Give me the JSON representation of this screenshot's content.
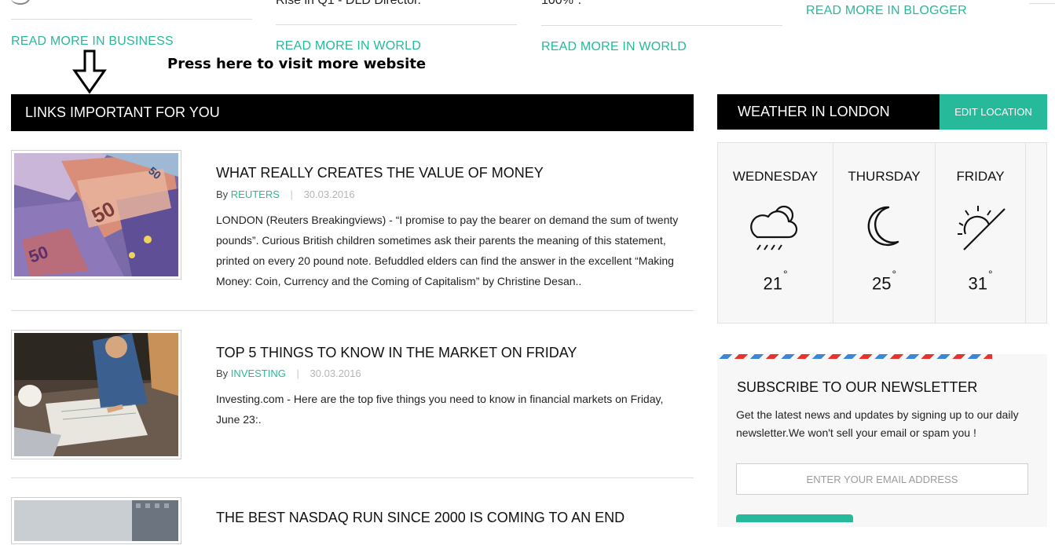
{
  "top_links": {
    "col1": "READ MORE IN BUSINESS",
    "col2_cut": "Rise in Q1 - DLD Director.",
    "col2": "READ MORE IN WORLD",
    "col3_cut": "100%\".",
    "col3": "READ MORE IN WORLD",
    "col4": "READ MORE IN BLOGGER"
  },
  "annotation": {
    "text": "Press here to visit more website"
  },
  "links_section": {
    "title": "LINKS IMPORTANT FOR YOU"
  },
  "articles": [
    {
      "title": "WHAT REALLY CREATES THE VALUE OF MONEY",
      "by": "By",
      "source": "REUTERS",
      "sep": "|",
      "date": "30.03.2016",
      "excerpt": "LONDON (Reuters Breakingviews) - “I promise to pay the bearer on demand the sum of twenty pounds”. Curious British children sometimes ask their parents the meaning of this statement, printed on every 20 pound note. Befuddled elders can find the answer in the excellent “Making Money: Coin, Currency and the Coming of Capitalism” by Christine Desan..",
      "image": "euro-banknotes-photo"
    },
    {
      "title": "TOP 5 THINGS TO KNOW IN THE MARKET ON FRIDAY",
      "by": "By",
      "source": "INVESTING",
      "sep": "|",
      "date": "30.03.2016",
      "excerpt": "Investing.com - Here are the top five things you need to know in financial markets on Friday, June 23:.",
      "image": "office-desk-photo"
    },
    {
      "title": "THE BEST NASDAQ RUN SINCE 2000 IS COMING TO AN END",
      "image": "city-skyline-photo"
    }
  ],
  "weather": {
    "title": "WEATHER IN LONDON",
    "edit_label": "EDIT LOCATION",
    "days": [
      {
        "day": "WEDNESDAY",
        "temp": "21",
        "icon": "cloud-rain-icon"
      },
      {
        "day": "THURSDAY",
        "temp": "25",
        "icon": "moon-icon"
      },
      {
        "day": "FRIDAY",
        "temp": "31",
        "icon": "sunset-icon"
      }
    ],
    "degree": "°"
  },
  "newsletter": {
    "title": "SUBSCRIBE TO OUR NEWSLETTER",
    "text": "Get the latest news and updates by signing up to our daily newsletter.We won't sell your email or spam you !",
    "placeholder": "ENTER YOUR EMAIL ADDRESS"
  },
  "colors": {
    "accent": "#26b99a",
    "bar": "#000000"
  }
}
